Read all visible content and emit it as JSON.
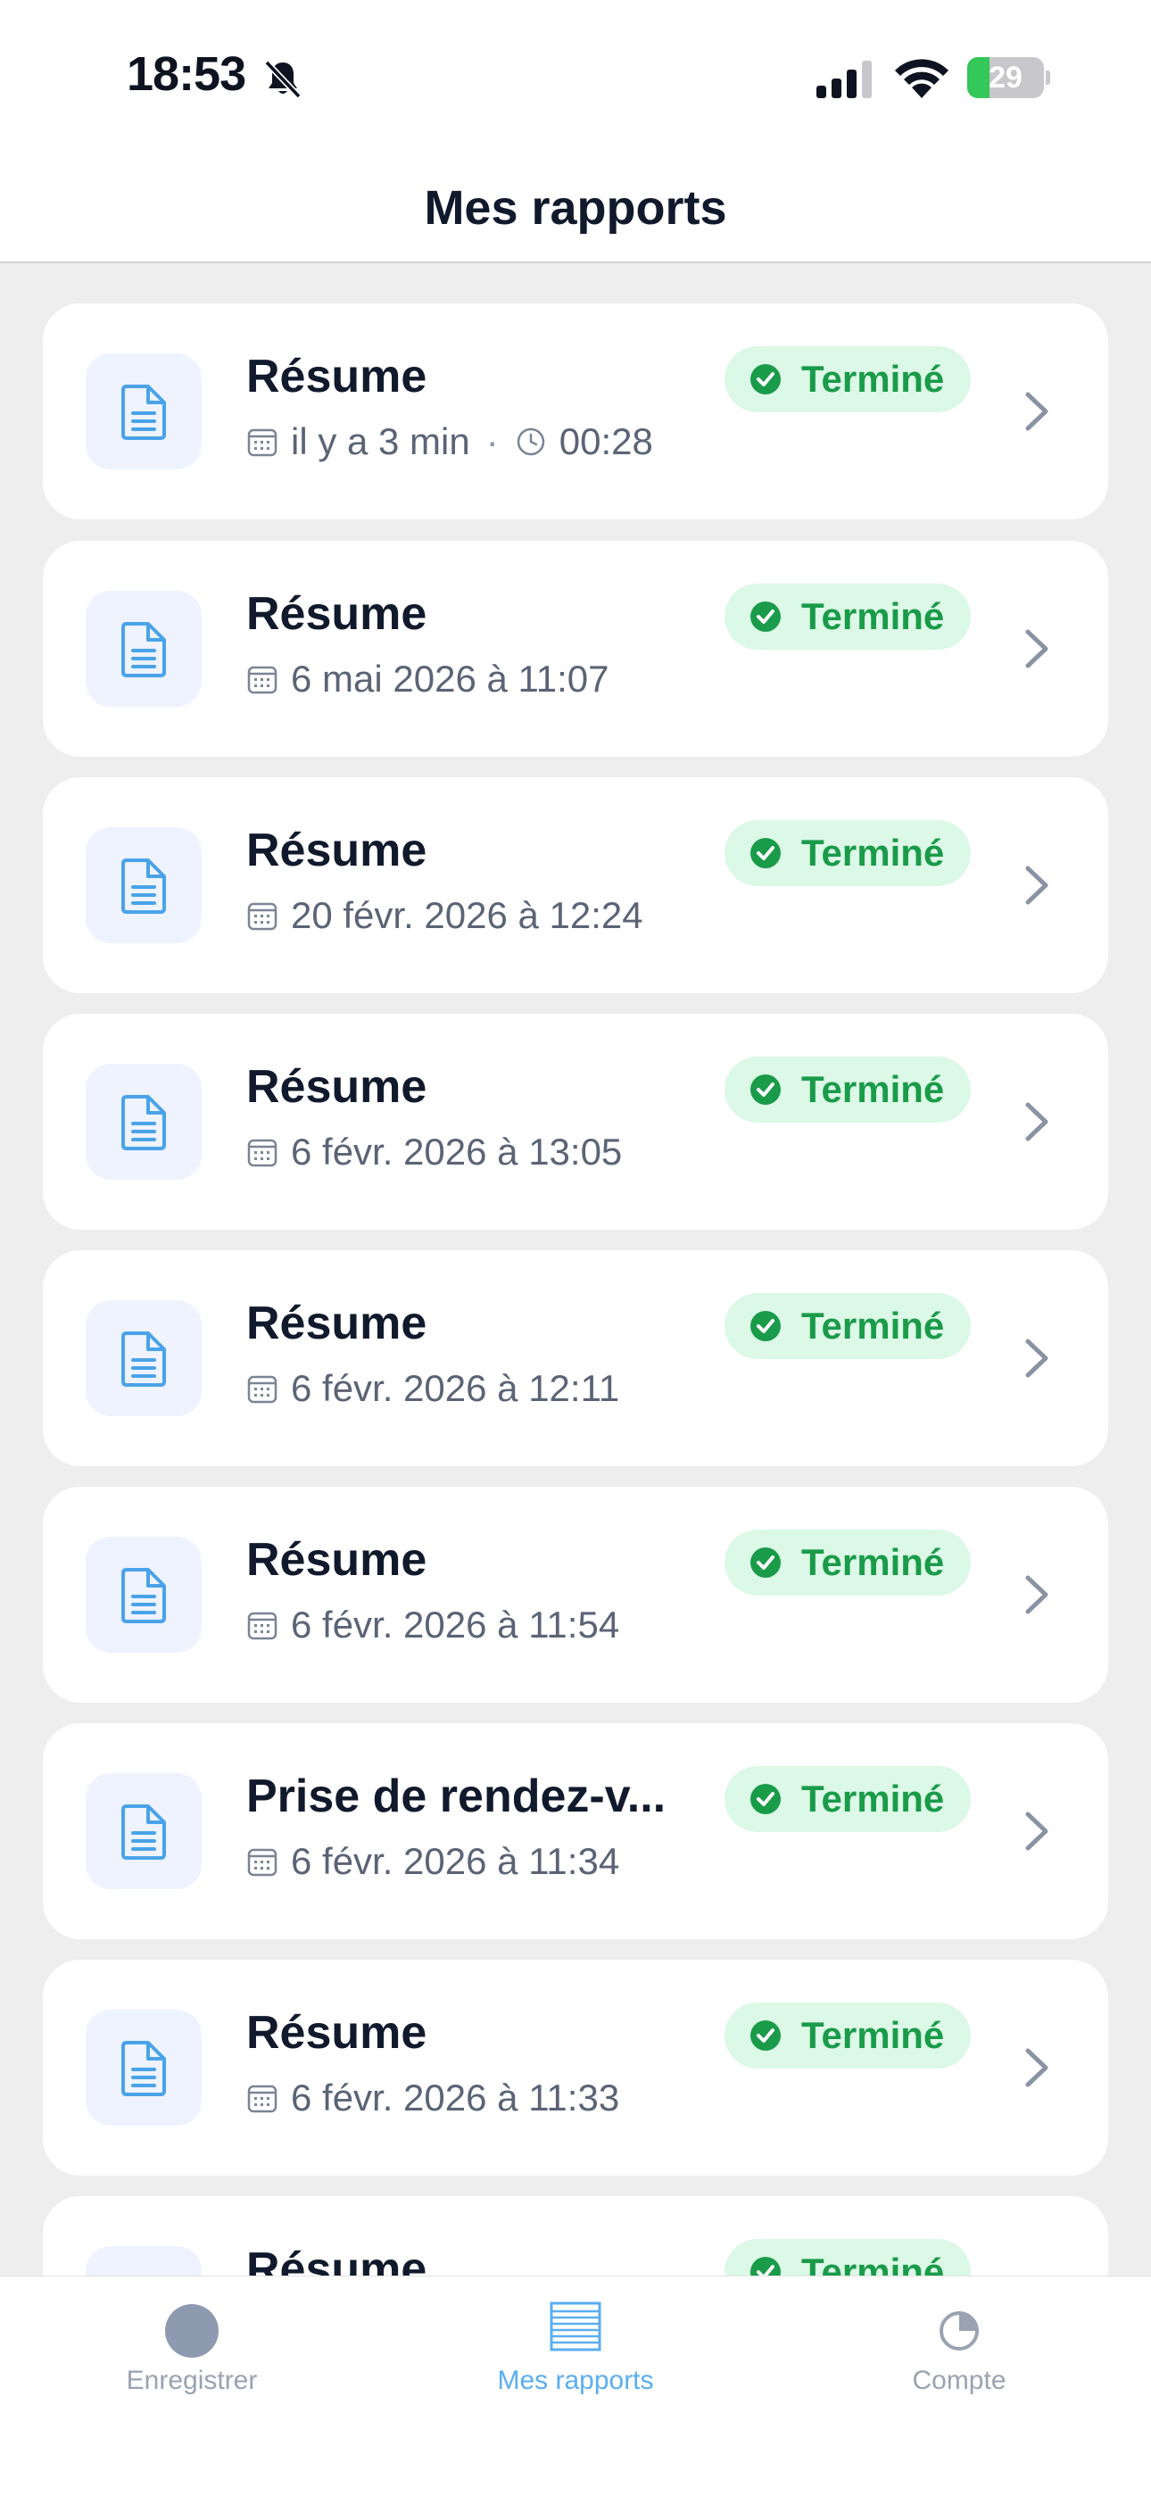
{
  "status_bar": {
    "time": "18:53",
    "battery": "29",
    "battery_level": 0.29
  },
  "header": {
    "title": "Mes rapports"
  },
  "reports": [
    {
      "title": "Résume",
      "date": "il y a 3 min",
      "duration": "00:28",
      "status": "Terminé"
    },
    {
      "title": "Résume",
      "date": "6 mai 2026 à 11:07",
      "status": "Terminé"
    },
    {
      "title": "Résume",
      "date": "20 févr. 2026 à 12:24",
      "status": "Terminé"
    },
    {
      "title": "Résume",
      "date": "6 févr. 2026 à 13:05",
      "status": "Terminé"
    },
    {
      "title": "Résume",
      "date": "6 févr. 2026 à 12:11",
      "status": "Terminé"
    },
    {
      "title": "Résume",
      "date": "6 févr. 2026 à 11:54",
      "status": "Terminé"
    },
    {
      "title": "Prise de rendez-v...",
      "date": "6 févr. 2026 à 11:34",
      "status": "Terminé"
    },
    {
      "title": "Résume",
      "date": "6 févr. 2026 à 11:33",
      "status": "Terminé"
    },
    {
      "title": "Résume",
      "date": "",
      "status": "Terminé"
    }
  ],
  "tabbar": {
    "tabs": [
      {
        "label": "Enregistrer",
        "icon": "record-icon",
        "active": false
      },
      {
        "label": "Mes rapports",
        "icon": "reports-icon",
        "active": true
      },
      {
        "label": "Compte",
        "icon": "account-icon",
        "active": false
      }
    ]
  },
  "colors": {
    "accent": "#5aaef0",
    "success": "#1a9b4a",
    "success_bg": "#dcf8e6",
    "text_primary": "#111a2c",
    "text_secondary": "#5b6476"
  }
}
